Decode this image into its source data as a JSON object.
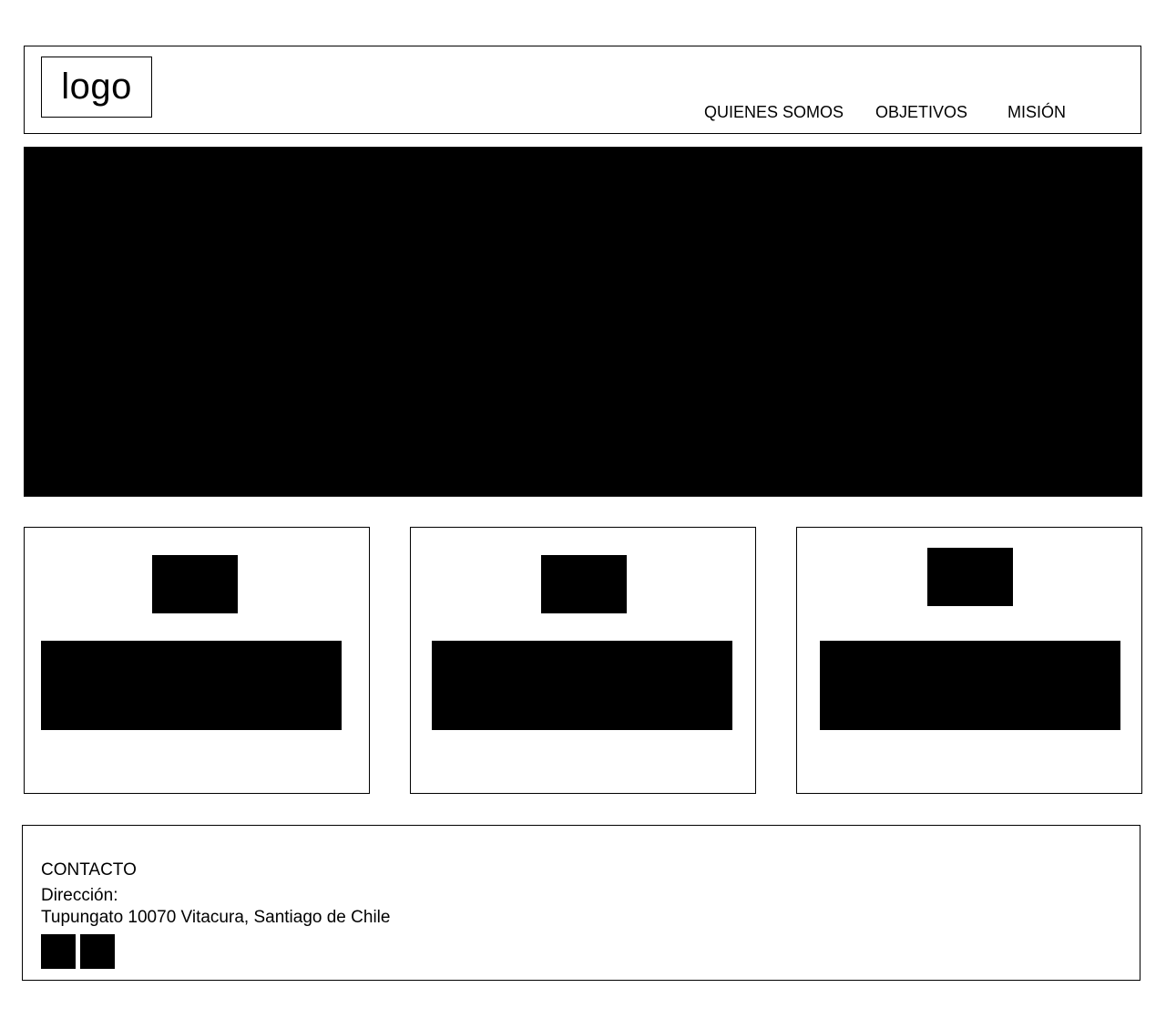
{
  "header": {
    "logo_text": "logo",
    "nav": [
      {
        "label": "QUIENES SOMOS"
      },
      {
        "label": "OBJETIVOS"
      },
      {
        "label": "MISIÓN"
      }
    ]
  },
  "footer": {
    "heading": "CONTACTO",
    "address_label": "Dirección:",
    "address": "Tupungato 10070 Vitacura, Santiago de Chile"
  }
}
